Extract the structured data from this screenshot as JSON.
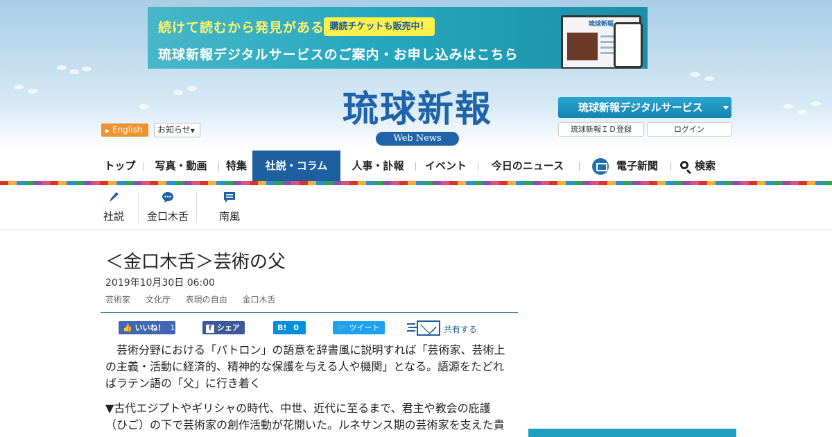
{
  "banner": {
    "line1": "続けて読むから発見がある",
    "badge": "購読チケットも販売中！",
    "line2": "琉球新報デジタルサービスのご案内・お申し込みはこちら",
    "device_title": "琉球新報"
  },
  "header": {
    "english": "English",
    "notice": "お知らせ",
    "logo_main": "琉球新報",
    "logo_sub": "Web News",
    "digital_service": "琉球新報デジタルサービス",
    "register": "琉球新報ＩＤ登録",
    "login": "ログイン"
  },
  "nav": {
    "items": [
      "トップ",
      "写真・動画",
      "特集",
      "社説・コラム",
      "人事・訃報",
      "イベント",
      "今日のニュース",
      "電子新聞",
      "検索"
    ],
    "active": "社説・コラム"
  },
  "subnav": {
    "items": [
      "社説",
      "金口木舌",
      "南風"
    ]
  },
  "article": {
    "title": "＜金口木舌＞芸術の父",
    "date": "2019年10月30日 06:00",
    "tags": [
      "芸術家",
      "文化庁",
      "表現の自由",
      "金口木舌"
    ],
    "paragraph1": "芸術分野における「パトロン」の語意を辞書風に説明すれば「芸術家、芸術上の主義・活動に経済的、精神的な保護を与える人や機関」となる。語源をたどればラテン語の「父」に行き着く",
    "paragraph2": "▼古代エジプトやギリシャの時代、中世、近代に至るまで、君主や教会の庇護（ひご）の下で芸術家の創作活動が花開いた。ルネサンス期の芸術家を支えた貴"
  },
  "share": {
    "like": "いいね！",
    "like_count": "1",
    "facebook": "シェア",
    "hatena_count": "0",
    "tweet": "ツイート",
    "mail": "共有する"
  }
}
